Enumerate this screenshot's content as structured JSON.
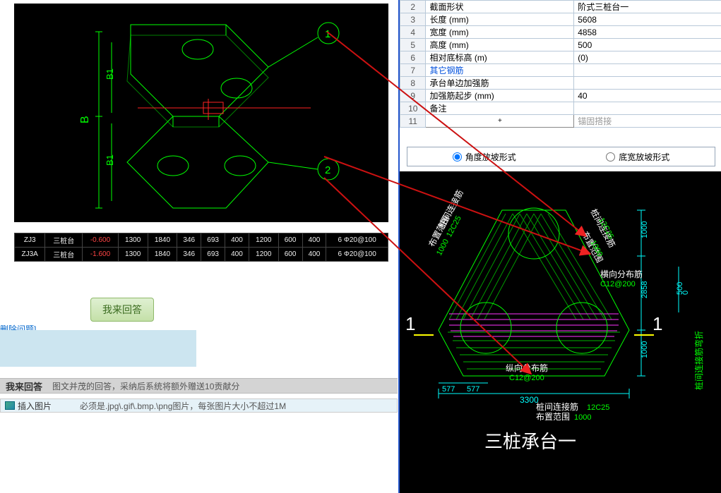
{
  "left": {
    "table": {
      "rows": [
        {
          "c0": "ZJ3",
          "c1": "三桩台",
          "c2": "-0.600",
          "c3": "1300",
          "c4": "1840",
          "c5": "346",
          "c6": "693",
          "c7": "400",
          "c8": "1200",
          "c9": "600",
          "c10": "400",
          "c11": "6 Φ20@100"
        },
        {
          "c0": "ZJ3A",
          "c1": "三桩台",
          "c2": "-1.600",
          "c3": "1300",
          "c4": "1840",
          "c5": "346",
          "c6": "693",
          "c7": "400",
          "c8": "1200",
          "c9": "600",
          "c10": "400",
          "c11": "6 Φ20@100"
        }
      ]
    },
    "answer_btn": "我来回答",
    "delete_link": "删除问题]",
    "ans_header_title": "我来回答",
    "ans_header_desc": "图文并茂的回答，采纳后系统将额外赠送10贡献分",
    "insert_label": "插入图片",
    "insert_desc": "必须是.jpg\\.gif\\.bmp.\\png图片，每张图片大小不超过1M"
  },
  "props": {
    "rows": [
      {
        "n": "2",
        "name": "截面形状",
        "val": "阶式三桩台一"
      },
      {
        "n": "3",
        "name": "长度 (mm)",
        "val": "5608"
      },
      {
        "n": "4",
        "name": "宽度 (mm)",
        "val": "4858"
      },
      {
        "n": "5",
        "name": "高度 (mm)",
        "val": "500"
      },
      {
        "n": "6",
        "name": "相对底标高 (m)",
        "val": "(0)"
      },
      {
        "n": "7",
        "name": "其它钢筋",
        "val": "",
        "blue": true
      },
      {
        "n": "8",
        "name": "承台单边加强筋",
        "val": ""
      },
      {
        "n": "9",
        "name": "加强筋起步 (mm)",
        "val": "40"
      },
      {
        "n": "10",
        "name": "备注",
        "val": ""
      },
      {
        "n": "11",
        "name": "锚固搭接",
        "val": "",
        "plus": true,
        "gray": true
      }
    ]
  },
  "radio": {
    "opt1": "角度放坡形式",
    "opt2": "底宽放坡形式",
    "selected": "opt1"
  },
  "cad1": {
    "labels": {
      "B": "B",
      "B1a": "B1",
      "B1b": "B1",
      "circle1": "1",
      "circle2": "2"
    }
  },
  "cad2": {
    "title": "三桩承台一",
    "labels": {
      "conn1": "桩间连接筋",
      "conn1v": "12C25",
      "range1": "布置范围",
      "range1v": "1000",
      "conn2": "桩间连接筋",
      "conn2v": "12C25",
      "range2": "布置范围",
      "range2v": "1000",
      "horiz": "横向分布筋",
      "horizv": "C12@200",
      "vert": "纵向分布筋",
      "vertv": "C12@200",
      "conn3": "桩间连接筋",
      "conn3v": "12C25",
      "range3": "布置范围",
      "range3v": "1000",
      "d3300": "3300",
      "d577a": "577",
      "d577b": "577",
      "d1000a": "1000",
      "d1000b": "1000",
      "d2858": "2858",
      "d500": "500",
      "d0": "0",
      "one_l": "1",
      "one_r": "1",
      "vlabel": "桩间连接筋弯折"
    }
  }
}
